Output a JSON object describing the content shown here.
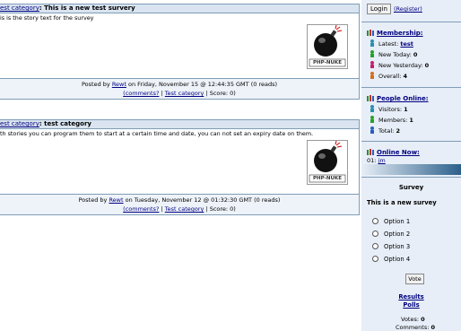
{
  "stories": [
    {
      "topic": "est category",
      "title": "This is a new test survery",
      "text": "is is the story text for the survey",
      "posted_prefix": "Posted by",
      "author": "Rewt",
      "date": "on Friday, November 15 @ 12:44:35 GMT (0 reads)",
      "comments": "(comments?",
      "category": "Test category",
      "score": "Score: 0)",
      "logo_text": "PHP-NUKE"
    },
    {
      "topic": "est category",
      "title": "test category",
      "text": "th stories you can program them to start at a certain time and date, you can not set an expiry date on them.",
      "posted_prefix": "Posted by",
      "author": "Rewt",
      "date": "on Tuesday, November 12 @ 01:32:30 GMT (0 reads)",
      "comments": "(comments?",
      "category": "Test category",
      "score": "Score: 0)",
      "logo_text": "PHP-NUKE"
    }
  ],
  "sidebar": {
    "login_label": "Login",
    "register_label": "(Register)",
    "membership": {
      "heading": "Membership:",
      "latest_label": "Latest:",
      "latest_user": "test",
      "new_today_label": "New Today:",
      "new_today": "0",
      "new_yesterday_label": "New Yesterday:",
      "new_yesterday": "0",
      "overall_label": "Overall:",
      "overall": "4"
    },
    "people_online": {
      "heading": "People Online:",
      "visitors_label": "Visitors:",
      "visitors": "1",
      "members_label": "Members:",
      "members": "1",
      "total_label": "Total:",
      "total": "2"
    },
    "online_now": {
      "heading": "Online Now:",
      "entry_num": "01:",
      "entry_user": "jm"
    },
    "survey": {
      "heading": "Survey",
      "question": "This is a new survey",
      "options": [
        "Option 1",
        "Option 2",
        "Option 3",
        "Option 4"
      ],
      "vote_label": "Vote",
      "results_label": "Results",
      "polls_label": "Polls",
      "votes_label": "Votes:",
      "votes": "0",
      "comments_label": "Comments:",
      "comments": "0"
    }
  },
  "colors": {
    "title_bar": "#d9e4f0",
    "border": "#7f9db9",
    "sidebar_bg": "#e7eef7",
    "link": "#000080",
    "gradient_dark": "#2b5f8a"
  }
}
